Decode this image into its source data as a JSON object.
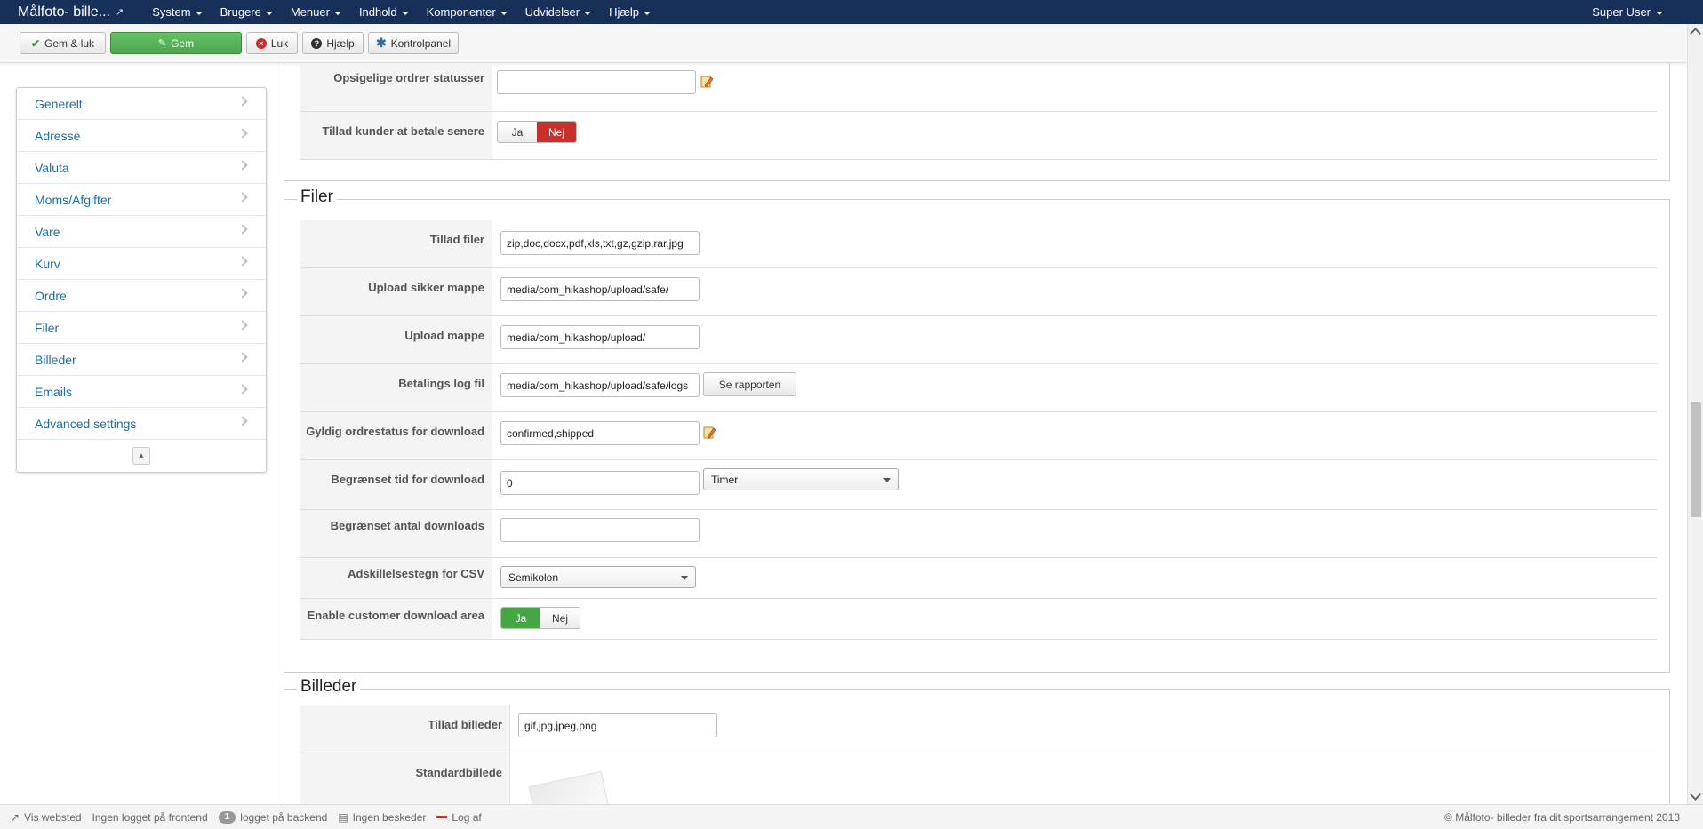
{
  "navbar": {
    "brand": "Målfoto- bille...",
    "menu": [
      "System",
      "Brugere",
      "Menuer",
      "Indhold",
      "Komponenter",
      "Udvidelser",
      "Hjælp"
    ],
    "user": "Super User"
  },
  "toolbar": {
    "save_close": "Gem & luk",
    "save": "Gem",
    "close": "Luk",
    "help": "Hjælp",
    "control_panel": "Kontrolpanel"
  },
  "sidebar": {
    "items": [
      "Generelt",
      "Adresse",
      "Valuta",
      "Moms/Afgifter",
      "Vare",
      "Kurv",
      "Ordre",
      "Filer",
      "Billeder",
      "Emails",
      "Advanced settings"
    ]
  },
  "order_section": {
    "cancellable_statuses_label": "Opsigelige ordrer statusser",
    "cancellable_statuses_value": "",
    "pay_later_label": "Tillad kunder at betale senere",
    "yes": "Ja",
    "no": "Nej",
    "pay_later_selected": "Nej"
  },
  "files_section": {
    "legend": "Filer",
    "allowed_files_label": "Tillad filer",
    "allowed_files_value": "zip,doc,docx,pdf,xls,txt,gz,gzip,rar,jpg",
    "upload_secure_label": "Upload sikker mappe",
    "upload_secure_value": "media/com_hikashop/upload/safe/",
    "upload_folder_label": "Upload mappe",
    "upload_folder_value": "media/com_hikashop/upload/",
    "payment_log_label": "Betalings log fil",
    "payment_log_value": "media/com_hikashop/upload/safe/logs",
    "see_report": "Se rapporten",
    "download_status_label": "Gyldig ordrestatus for download",
    "download_status_value": "confirmed,shipped",
    "download_time_label": "Begrænset tid for download",
    "download_time_value": "0",
    "download_time_unit": "Timer",
    "download_count_label": "Begrænset antal downloads",
    "download_count_value": "",
    "csv_sep_label": "Adskillelsestegn for CSV",
    "csv_sep_value": "Semikolon",
    "download_area_label": "Enable customer download area",
    "yes": "Ja",
    "no": "Nej",
    "download_area_selected": "Ja"
  },
  "images_section": {
    "legend": "Billeder",
    "allowed_images_label": "Tillad billeder",
    "allowed_images_value": "gif,jpg,jpeg,png",
    "default_image_label": "Standardbillede"
  },
  "statusbar": {
    "view_site": "Vis websted",
    "frontend": "Ingen logget på frontend",
    "backend_count": "1",
    "backend": "logget på backend",
    "messages": "Ingen beskeder",
    "logout": "Log af",
    "copyright": "© Målfoto- billeder fra dit sportsarrangement 2013"
  },
  "colors": {
    "navbar": "#17305a",
    "link": "#1a6fa5",
    "save_green": "#51a351",
    "no_red": "#c9302c",
    "yes_green": "#46a546"
  }
}
